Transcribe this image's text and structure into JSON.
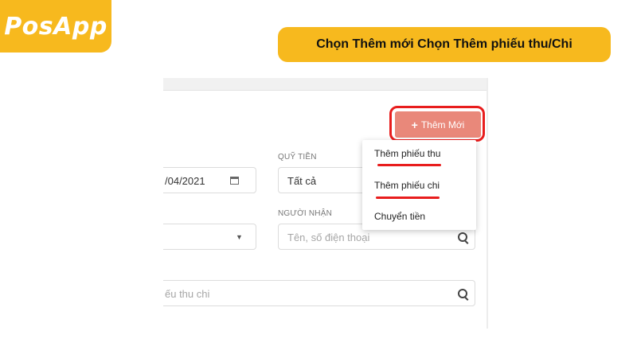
{
  "brand": {
    "logo": "PosApp"
  },
  "headline": "Chọn Thêm mới Chọn Thêm phiếu thu/Chi",
  "form": {
    "date_partial": "/04/2021",
    "fund_label": "QUỸ TIỀN",
    "fund_value": "Tất cả",
    "receiver_label": "NGƯỜI NHẬN",
    "receiver_placeholder": "Tên, số điện thoại",
    "search_placeholder_partial": "ếu thu chi"
  },
  "actions": {
    "add_new_label": "Thêm Mới",
    "add_icon": "plus-icon"
  },
  "dropdown": {
    "items": [
      "Thêm phiếu thu",
      "Thêm phiếu chi",
      "Chuyển tiền"
    ]
  },
  "colors": {
    "brand_yellow": "#f7b91e",
    "button": "#e9887a",
    "highlight_red": "#e81d1d"
  }
}
